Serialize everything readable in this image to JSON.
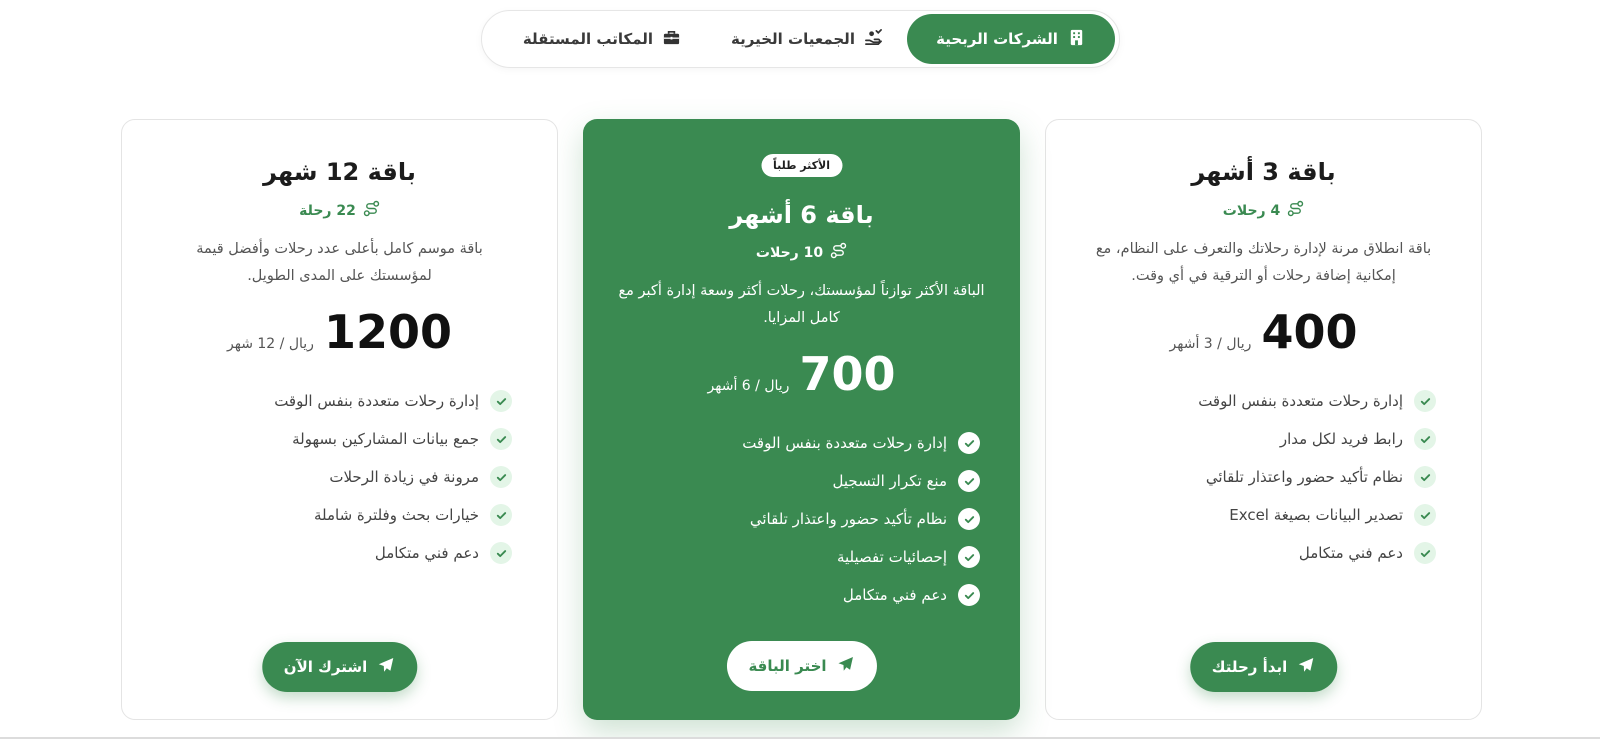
{
  "tabs": [
    {
      "label": "الشركات الربحية",
      "icon": "building-icon",
      "active": true
    },
    {
      "label": "الجمعيات الخيرية",
      "icon": "charity-hand-icon",
      "active": false
    },
    {
      "label": "المكاتب المستقلة",
      "icon": "briefcase-icon",
      "active": false
    }
  ],
  "plans": [
    {
      "title": "باقة 3 أشهر",
      "trips": "4 رحلات",
      "description": "باقة انطلاق مرنة لإدارة رحلاتك والتعرف على النظام، مع إمكانية إضافة رحلات أو الترقية في أي وقت.",
      "price": "400",
      "unit": "ريال / 3 أشهر",
      "features": [
        "إدارة رحلات متعددة بنفس الوقت",
        "رابط فريد لكل مدار",
        "نظام تأكيد حضور واعتذار تلقائي",
        "تصدير البيانات بصيغة Excel",
        "دعم فني متكامل"
      ],
      "cta": "ابدأ رحلتك"
    },
    {
      "badge": "الأكثر طلباً",
      "title": "باقة 6 أشهر",
      "trips": "10 رحلات",
      "description": "الباقة الأكثر توازناً لمؤسستك، رحلات أكثر وسعة إدارة أكبر مع كامل المزايا.",
      "price": "700",
      "unit": "ريال / 6 أشهر",
      "features": [
        "إدارة رحلات متعددة بنفس الوقت",
        "منع تكرار التسجيل",
        "نظام تأكيد حضور واعتذار تلقائي",
        "إحصائيات تفصيلية",
        "دعم فني متكامل"
      ],
      "cta": "اختر الباقة"
    },
    {
      "title": "باقة 12 شهر",
      "trips": "22 رحلة",
      "description": "باقة موسم كامل بأعلى عدد رحلات وأفضل قيمة لمؤسستك على المدى الطويل.",
      "price": "1200",
      "unit": "ريال / 12 شهر",
      "features": [
        "إدارة رحلات متعددة بنفس الوقت",
        "جمع بيانات المشاركين بسهولة",
        "مرونة في زيادة الرحلات",
        "خيارات بحث وفلترة شاملة",
        "دعم فني متكامل"
      ],
      "cta": "اشترك الآن"
    }
  ],
  "colors": {
    "accent": "#3a8a51",
    "check_bg": "#e3f5e7"
  }
}
